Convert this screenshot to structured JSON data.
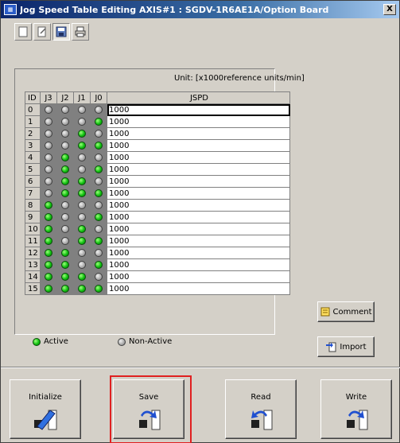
{
  "window": {
    "title": "Jog Speed Table Editing AXIS#1 : SGDV-1R6AE1A/Option Board",
    "close_label": "X"
  },
  "toolbar": {
    "buttons": [
      {
        "icon": "new-document-icon"
      },
      {
        "icon": "open-folder-icon"
      },
      {
        "icon": "save-disk-icon",
        "pressed": true
      },
      {
        "icon": "printer-icon"
      }
    ]
  },
  "table": {
    "unit_label": "Unit: [x1000reference units/min]",
    "headers": {
      "id": "ID",
      "j3": "J3",
      "j2": "J2",
      "j1": "J1",
      "j0": "J0",
      "jspd": "JSPD"
    },
    "rows": [
      {
        "id": "0",
        "leds": [
          0,
          0,
          0,
          0
        ],
        "jspd": "1000"
      },
      {
        "id": "1",
        "leds": [
          0,
          0,
          0,
          1
        ],
        "jspd": "1000"
      },
      {
        "id": "2",
        "leds": [
          0,
          0,
          1,
          0
        ],
        "jspd": "1000"
      },
      {
        "id": "3",
        "leds": [
          0,
          0,
          1,
          1
        ],
        "jspd": "1000"
      },
      {
        "id": "4",
        "leds": [
          0,
          1,
          0,
          0
        ],
        "jspd": "1000"
      },
      {
        "id": "5",
        "leds": [
          0,
          1,
          0,
          1
        ],
        "jspd": "1000"
      },
      {
        "id": "6",
        "leds": [
          0,
          1,
          1,
          0
        ],
        "jspd": "1000"
      },
      {
        "id": "7",
        "leds": [
          0,
          1,
          1,
          1
        ],
        "jspd": "1000"
      },
      {
        "id": "8",
        "leds": [
          1,
          0,
          0,
          0
        ],
        "jspd": "1000"
      },
      {
        "id": "9",
        "leds": [
          1,
          0,
          0,
          1
        ],
        "jspd": "1000"
      },
      {
        "id": "10",
        "leds": [
          1,
          0,
          1,
          0
        ],
        "jspd": "1000"
      },
      {
        "id": "11",
        "leds": [
          1,
          0,
          1,
          1
        ],
        "jspd": "1000"
      },
      {
        "id": "12",
        "leds": [
          1,
          1,
          0,
          0
        ],
        "jspd": "1000"
      },
      {
        "id": "13",
        "leds": [
          1,
          1,
          0,
          1
        ],
        "jspd": "1000"
      },
      {
        "id": "14",
        "leds": [
          1,
          1,
          1,
          0
        ],
        "jspd": "1000"
      },
      {
        "id": "15",
        "leds": [
          1,
          1,
          1,
          1
        ],
        "jspd": "1000"
      }
    ]
  },
  "legend": {
    "active": "Active",
    "non_active": "Non-Active"
  },
  "side_buttons": {
    "comment": "Comment",
    "import": "Import"
  },
  "bottom_buttons": {
    "initialize": "Initialize",
    "save": "Save",
    "read": "Read",
    "write": "Write"
  },
  "colors": {
    "led_on": "#10c010",
    "led_off": "#a8a8a8",
    "highlight": "#e02020"
  }
}
